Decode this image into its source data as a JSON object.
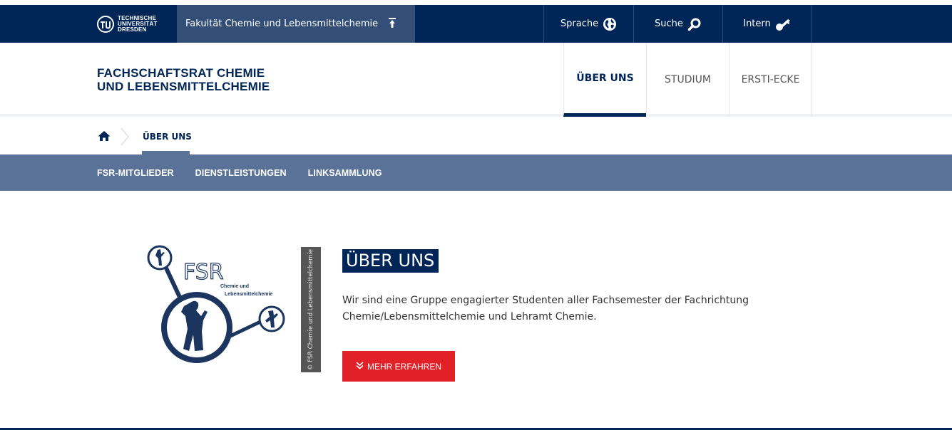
{
  "topbar": {
    "logo_lines": [
      "TECHNISCHE",
      "UNIVERSITÄT",
      "DRESDEN"
    ],
    "faculty_label": "Fakultät Chemie und Lebensmittelchemie",
    "tools": {
      "language_label": "Sprache",
      "search_label": "Suche",
      "intern_label": "Intern"
    }
  },
  "header": {
    "title_line1": "FACHSCHAFTSRAT CHEMIE",
    "title_line2": "UND LEBENSMITTELCHEMIE",
    "nav": [
      {
        "label": "ÜBER UNS",
        "active": true
      },
      {
        "label": "STUDIUM",
        "active": false
      },
      {
        "label": "ERSTI-ECKE",
        "active": false
      }
    ]
  },
  "breadcrumb": {
    "current": "ÜBER UNS"
  },
  "subnav": {
    "items": [
      "FSR-MITGLIEDER",
      "DIENSTLEISTUNGEN",
      "LINKSAMMLUNG"
    ]
  },
  "main": {
    "logo_text": "FSR",
    "logo_subtext_line1": "Chemie und",
    "logo_subtext_line2": "Lebensmittelchemie",
    "copyright": "© FSR Chemie und Lebensmittelchemie",
    "title": "ÜBER UNS",
    "text": "Wir sind eine Gruppe engagierter Studenten aller Fachsemester der Fachrichtung Chemie/Lebensmittelchemie und Lehramt Chemie.",
    "button_label": "MEHR ERFAHREN"
  },
  "colors": {
    "brand_dark": "#002557",
    "subnav_bg": "#5a7198",
    "accent_red": "#e12127"
  },
  "icons": {
    "tu_logo": "tu-dresden-logo-icon",
    "faculty_up": "arrow-up-icon",
    "language": "globe-icon",
    "search": "search-icon",
    "intern": "key-icon",
    "home": "home-icon",
    "more": "double-chevron-down-icon"
  }
}
